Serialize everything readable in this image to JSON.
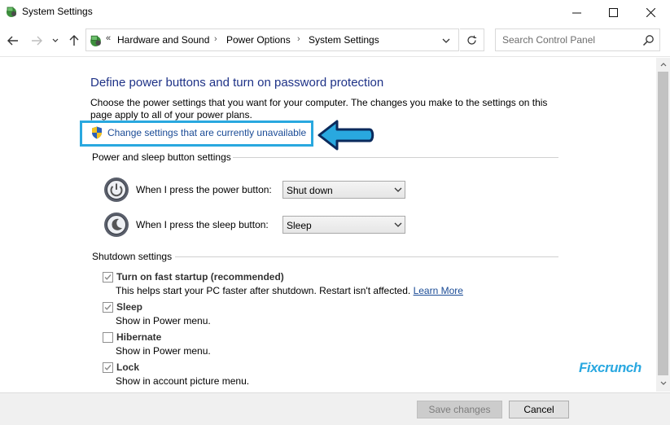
{
  "window": {
    "title": "System Settings"
  },
  "address": {
    "crumbs": [
      "Hardware and Sound",
      "Power Options",
      "System Settings"
    ],
    "chevron_left": "«"
  },
  "search": {
    "placeholder": "Search Control Panel"
  },
  "content": {
    "heading": "Define power buttons and turn on password protection",
    "description": "Choose the power settings that you want for your computer. The changes you make to the settings on this page apply to all of your power plans.",
    "change_link": "Change settings that are currently unavailable",
    "power_section": {
      "title": "Power and sleep button settings",
      "power_label": "When I press the power button:",
      "power_value": "Shut down",
      "sleep_label": "When I press the sleep button:",
      "sleep_value": "Sleep"
    },
    "shutdown_section": {
      "title": "Shutdown settings",
      "items": [
        {
          "label": "Turn on fast startup (recommended)",
          "desc": "This helps start your PC faster after shutdown. Restart isn't affected.",
          "link": "Learn More",
          "checked": true
        },
        {
          "label": "Sleep",
          "desc": "Show in Power menu.",
          "checked": true
        },
        {
          "label": "Hibernate",
          "desc": "Show in Power menu.",
          "checked": false
        },
        {
          "label": "Lock",
          "desc": "Show in account picture menu.",
          "checked": true
        }
      ]
    }
  },
  "watermark": "Fixcrunch",
  "footer": {
    "save_label": "Save changes",
    "cancel_label": "Cancel"
  },
  "colors": {
    "heading": "#1e3287",
    "link": "#1a4b96",
    "highlight": "#29a8df"
  },
  "icons": {
    "app": "control-panel-icon",
    "shield": "uac-shield-icon",
    "power": "power-button-icon",
    "sleep": "sleep-button-icon",
    "search": "magnifier-icon"
  }
}
